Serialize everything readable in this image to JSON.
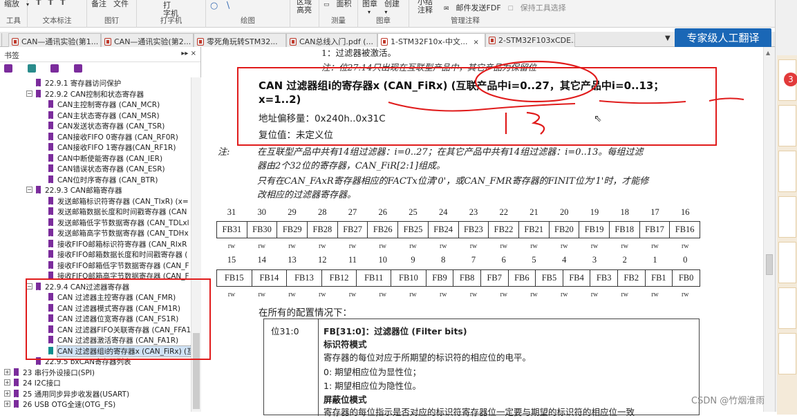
{
  "ribbon": {
    "groups": [
      {
        "items": [
          "缩放"
        ],
        "label": "工具"
      },
      {
        "items": [
          "T",
          "T",
          "T"
        ],
        "label": "文本标注"
      },
      {
        "items": [
          "备注",
          "文件"
        ],
        "label": "图钉"
      },
      {
        "items": [
          "打",
          "字机"
        ],
        "label": "打字机"
      },
      {
        "items": [
          "○",
          "∖"
        ],
        "label": "绘图"
      },
      {
        "items": [
          "区域",
          "高亮"
        ],
        "label": ""
      },
      {
        "items": [
          "面积"
        ],
        "label": "测量"
      },
      {
        "items": [
          "图章",
          "创建"
        ],
        "label": "图章"
      },
      {
        "items": [
          "小结",
          "注释",
          "邮件发送FDF",
          "保持工具选择"
        ],
        "label": "管理注释"
      }
    ]
  },
  "tabs": [
    {
      "label": "CAN—通讯实验(第1...",
      "active": false,
      "closable": false
    },
    {
      "label": "CAN—通讯实验(第2...",
      "active": false,
      "closable": false
    },
    {
      "label": "零死角玩转STM32...",
      "active": false,
      "closable": false
    },
    {
      "label": "CAN总线入门.pdf (...",
      "active": false,
      "closable": false
    },
    {
      "label": "1-STM32F10x-中文...",
      "active": true,
      "closable": true,
      "close_glyph": "×"
    },
    {
      "label": "2-STM32F103xCDE...",
      "active": false,
      "closable": false
    }
  ],
  "tab_menu_glyph": "▼",
  "expert_button": "专家级人工翻译",
  "side_badge": "3",
  "sidebar": {
    "title": "书签",
    "controls": "▸▸ ×",
    "items": [
      {
        "label": "22.9.1 寄存器访问保护",
        "level": 2,
        "icon": "bookmark-icon"
      },
      {
        "label": "22.9.2 CAN控制和状态寄存器",
        "level": 2,
        "icon": "bookmark-icon",
        "expander": "−"
      },
      {
        "label": "CAN主控制寄存器 (CAN_MCR)",
        "level": 3,
        "icon": "bookmark-icon"
      },
      {
        "label": "CAN主状态寄存器 (CAN_MSR)",
        "level": 3,
        "icon": "bookmark-icon"
      },
      {
        "label": "CAN发送状态寄存器 (CAN_TSR)",
        "level": 3,
        "icon": "bookmark-icon"
      },
      {
        "label": "CAN接收FIFO 0寄存器 (CAN_RF0R)",
        "level": 3,
        "icon": "bookmark-icon"
      },
      {
        "label": "CAN接收FIFO 1寄存器(CAN_RF1R)",
        "level": 3,
        "icon": "bookmark-icon"
      },
      {
        "label": "CAN中断使能寄存器 (CAN_IER)",
        "level": 3,
        "icon": "bookmark-icon"
      },
      {
        "label": "CAN错误状态寄存器 (CAN_ESR)",
        "level": 3,
        "icon": "bookmark-icon"
      },
      {
        "label": "CAN位时序寄存器 (CAN_BTR)",
        "level": 3,
        "icon": "bookmark-icon"
      },
      {
        "label": "22.9.3 CAN邮箱寄存器",
        "level": 2,
        "icon": "bookmark-icon",
        "expander": "−"
      },
      {
        "label": "发送邮箱标识符寄存器 (CAN_TIxR) (x=",
        "level": 3,
        "icon": "bookmark-icon"
      },
      {
        "label": "发送邮箱数据长度和时间戳寄存器 (CAN",
        "level": 3,
        "icon": "bookmark-icon"
      },
      {
        "label": "发送邮箱低字节数据寄存器 (CAN_TDLxl",
        "level": 3,
        "icon": "bookmark-icon"
      },
      {
        "label": "发送邮箱高字节数据寄存器 (CAN_TDHx",
        "level": 3,
        "icon": "bookmark-icon"
      },
      {
        "label": "接收FIFO邮箱标识符寄存器 (CAN_RIxR",
        "level": 3,
        "icon": "bookmark-icon"
      },
      {
        "label": "接收FIFO邮箱数据长度和时间戳寄存器 (",
        "level": 3,
        "icon": "bookmark-icon"
      },
      {
        "label": "接收FIFO邮箱低字节数据寄存器 (CAN_F",
        "level": 3,
        "icon": "bookmark-icon"
      },
      {
        "label": "接收FIFO邮箱高字节数据寄存器 (CAN_F",
        "level": 3,
        "icon": "bookmark-icon"
      },
      {
        "label": "22.9.4 CAN过滤器寄存器",
        "level": 2,
        "icon": "bookmark-icon",
        "expander": "−"
      },
      {
        "label": "CAN 过滤器主控寄存器 (CAN_FMR)",
        "level": 3,
        "icon": "bookmark-icon"
      },
      {
        "label": "CAN 过滤器模式寄存器 (CAN_FM1R)",
        "level": 3,
        "icon": "bookmark-icon"
      },
      {
        "label": "CAN 过滤器位宽寄存器 (CAN_FS1R)",
        "level": 3,
        "icon": "bookmark-icon"
      },
      {
        "label": "CAN 过滤器FIFO关联寄存器 (CAN_FFA1",
        "level": 3,
        "icon": "bookmark-icon"
      },
      {
        "label": "CAN 过滤器激活寄存器 (CAN_FA1R)",
        "level": 3,
        "icon": "bookmark-icon"
      },
      {
        "label": "CAN 过滤器组i的寄存器x (CAN_FiRx) (互",
        "level": 3,
        "icon": "bookmark-icon",
        "selected": true
      },
      {
        "label": "22.9.5 bxCAN寄存器列表",
        "level": 2,
        "icon": "bookmark-icon"
      },
      {
        "label": "23 串行外设接口(SPI)",
        "level": 1,
        "icon": "bookmark-icon",
        "expander": "+"
      },
      {
        "label": "24 I2C接口",
        "level": 1,
        "icon": "bookmark-icon",
        "expander": "+"
      },
      {
        "label": "25 通用同步异步收发器(USART)",
        "level": 1,
        "icon": "bookmark-icon",
        "expander": "+"
      },
      {
        "label": "26 USB OTG全速(OTG_FS)",
        "level": 1,
        "icon": "bookmark-icon",
        "expander": "+"
      }
    ]
  },
  "document": {
    "prev_line1": "1：过滤器被激活。",
    "prev_line2": "注：位27:14只出现在互联型产品中，其它产品为保留位",
    "heading": "CAN 过滤器组i的寄存器x (CAN_FiRx) (互联产品中i=0..27，其它产品中i=0..13；",
    "heading2": "x=1..2)",
    "address_offset": "地址偏移量：0x240h..0x31C",
    "reset_value": "复位值：未定义位",
    "handwriting": "13",
    "note_label": "注:",
    "note_line1": "在互联型产品中共有14组过滤器：i=0..27；在其它产品中共有14组过滤器：i=0..13。每组过滤",
    "note_line2": "器由2个32位的寄存器，CAN_FiR[2:1]组成。",
    "note_line3": "只有在CAN_FAxR寄存器相应的FACTx位清'0'，或CAN_FMR寄存器的FINIT位为'1'时，才能修",
    "note_line4": "改相应的过滤器寄存器。",
    "high_bits": {
      "numbers": [
        "31",
        "30",
        "29",
        "28",
        "27",
        "26",
        "25",
        "24",
        "23",
        "22",
        "21",
        "20",
        "19",
        "18",
        "17",
        "16"
      ],
      "names": [
        "FB31",
        "FB30",
        "FB29",
        "FB28",
        "FB27",
        "FB26",
        "FB25",
        "FB24",
        "FB23",
        "FB22",
        "FB21",
        "FB20",
        "FB19",
        "FB18",
        "FB17",
        "FB16"
      ],
      "access": [
        "rw",
        "rw",
        "rw",
        "rw",
        "rw",
        "rw",
        "rw",
        "rw",
        "rw",
        "rw",
        "rw",
        "rw",
        "rw",
        "rw",
        "rw",
        "rw"
      ]
    },
    "low_bits": {
      "numbers": [
        "15",
        "14",
        "13",
        "12",
        "11",
        "10",
        "9",
        "8",
        "7",
        "6",
        "5",
        "4",
        "3",
        "2",
        "1",
        "0"
      ],
      "names": [
        "FB15",
        "FB14",
        "FB13",
        "FB12",
        "FB11",
        "FB10",
        "FB9",
        "FB8",
        "FB7",
        "FB6",
        "FB5",
        "FB4",
        "FB3",
        "FB2",
        "FB1",
        "FB0"
      ],
      "access": [
        "rw",
        "rw",
        "rw",
        "rw",
        "rw",
        "rw",
        "rw",
        "rw",
        "rw",
        "rw",
        "rw",
        "rw",
        "rw",
        "rw",
        "rw",
        "rw"
      ]
    },
    "config_intro": "在所有的配置情况下：",
    "field_bits": "位31:0",
    "field_title": "FB[31:0]：过滤器位 (Filter bits)",
    "id_mode": "标识符模式",
    "id_desc": "寄存器的每位对应于所期望的标识符的相应位的电平。",
    "id_0": "0: 期望相应位为显性位；",
    "id_1": "1: 期望相应位为隐性位。",
    "mask_mode": "屏蔽位模式",
    "mask_desc": "寄存器的每位指示是否对应的标识符寄存器位一定要与期望的标识符的相应位一致"
  },
  "watermark": "CSDN @竹烟淮雨",
  "colors": {
    "annotation_red": "#e01b1b",
    "expert_blue": "#1a67b6",
    "bookmark_purple": "#7b2c9c",
    "selected_bookmark_teal": "#0f8f8f"
  }
}
